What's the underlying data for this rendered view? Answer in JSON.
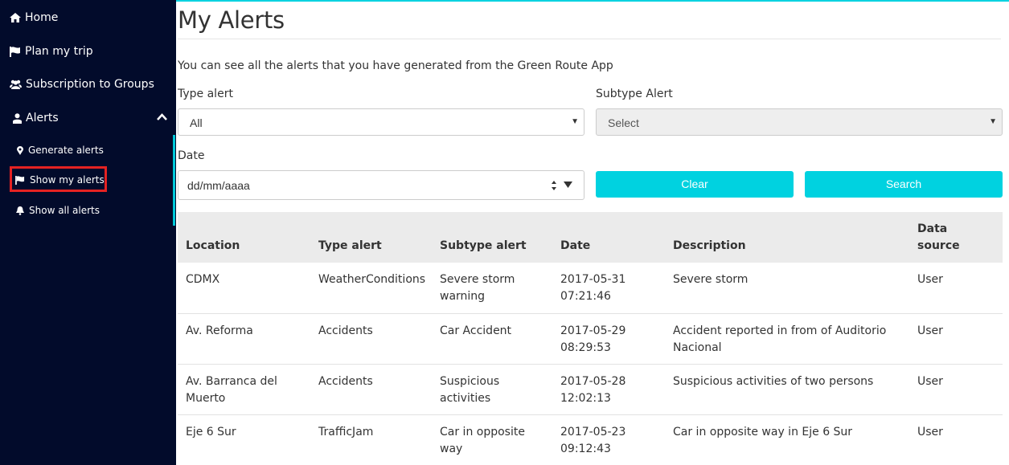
{
  "sidebar": {
    "items": [
      {
        "label": "Home",
        "icon": "home-icon"
      },
      {
        "label": "Plan my trip",
        "icon": "flag-icon"
      },
      {
        "label": "Subscription to Groups",
        "icon": "users-icon"
      },
      {
        "label": "Alerts",
        "icon": "user-icon"
      }
    ],
    "alerts_submenu": [
      {
        "label": "Generate alerts",
        "icon": "map-marker-icon"
      },
      {
        "label": "Show my alerts",
        "icon": "flag-icon",
        "active": true
      },
      {
        "label": "Show all alerts",
        "icon": "bell-icon"
      }
    ]
  },
  "page": {
    "title": "My Alerts",
    "intro": "You can see all the alerts that you have generated from the Green Route App"
  },
  "filters": {
    "type_label": "Type alert",
    "type_value": "All",
    "subtype_label": "Subtype Alert",
    "subtype_value": "Select",
    "date_label": "Date",
    "date_placeholder": "dd/mm/aaaa",
    "clear_label": "Clear",
    "search_label": "Search"
  },
  "table": {
    "headers": [
      "Location",
      "Type alert",
      "Subtype alert",
      "Date",
      "Description",
      "Data source"
    ],
    "rows": [
      [
        "CDMX",
        "WeatherConditions",
        "Severe storm warning",
        "2017-05-31 07:21:46",
        "Severe storm",
        "User"
      ],
      [
        "Av. Reforma",
        "Accidents",
        "Car Accident",
        "2017-05-29 08:29:53",
        "Accident reported in from of Auditorio Nacional",
        "User"
      ],
      [
        "Av. Barranca del Muerto",
        "Accidents",
        "Suspicious activities",
        "2017-05-28 12:02:13",
        "Suspicious activities of two persons",
        "User"
      ],
      [
        "Eje 6 Sur",
        "TrafficJam",
        "Car in opposite way",
        "2017-05-23 09:12:43",
        "Car in opposite way in Eje 6 Sur",
        "User"
      ]
    ]
  },
  "colors": {
    "sidebar_bg": "#020b2b",
    "accent": "#00d2e0",
    "active_outline": "#e52222",
    "table_header_bg": "#ebebeb"
  }
}
